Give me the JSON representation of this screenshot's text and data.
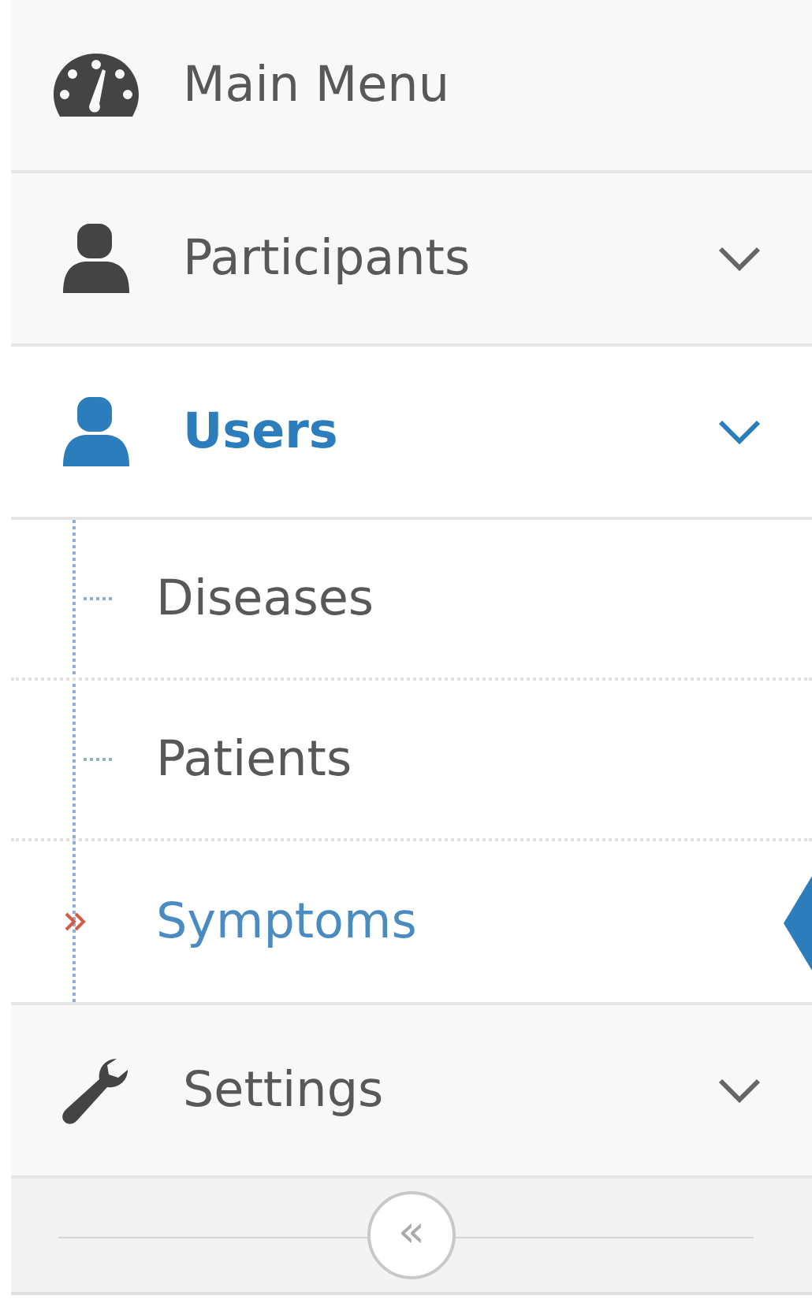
{
  "menu": [
    {
      "label": "Main Menu",
      "active": false
    },
    {
      "label": "Participants",
      "active": false,
      "has_submenu": true
    },
    {
      "label": "Users",
      "active": true,
      "has_submenu": true,
      "expanded": true,
      "children": [
        {
          "label": "Diseases",
          "selected": false
        },
        {
          "label": "Patients",
          "selected": false
        },
        {
          "label": "Symptoms",
          "selected": true
        }
      ]
    },
    {
      "label": "Settings",
      "active": false,
      "has_submenu": true
    }
  ],
  "collapse_button": {
    "label": "«"
  }
}
